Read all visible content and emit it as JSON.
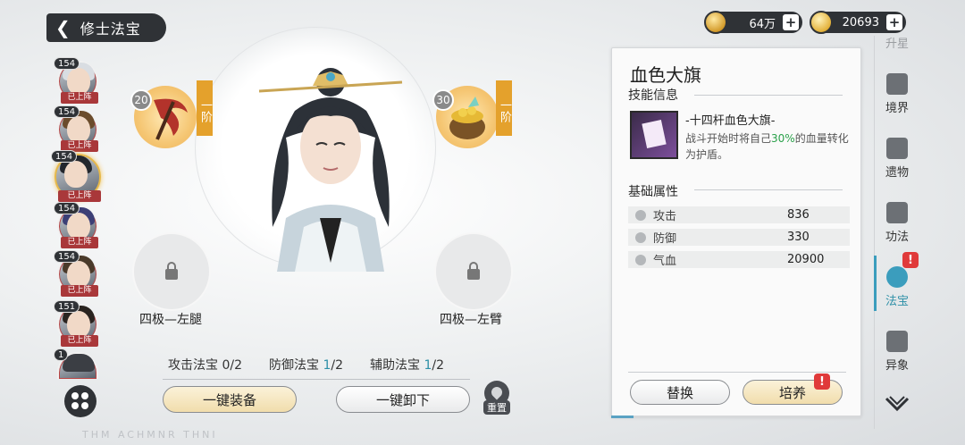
{
  "header": {
    "title": "修士法宝",
    "currencies": [
      {
        "icon": "copper-coin-icon",
        "value": "64万"
      },
      {
        "icon": "gold-ingot-icon",
        "value": "20693"
      }
    ]
  },
  "roster": [
    {
      "level": "154",
      "tag": "已上阵"
    },
    {
      "level": "154",
      "tag": "已上阵"
    },
    {
      "level": "154",
      "tag": "已上阵"
    },
    {
      "level": "154",
      "tag": "已上阵"
    },
    {
      "level": "154",
      "tag": "已上阵"
    },
    {
      "level": "151",
      "tag": "已上阵"
    },
    {
      "level": "1",
      "tag": ""
    }
  ],
  "slots": {
    "left_treasure": {
      "level": "20",
      "grade": "一阶"
    },
    "right_treasure": {
      "level": "30",
      "grade": "一阶"
    },
    "lock_left": "四极—左腿",
    "lock_right": "四极—左臂"
  },
  "counters": {
    "attack_label": "攻击法宝",
    "attack_value": "0/2",
    "defense_label": "防御法宝",
    "defense_cur": "1",
    "defense_max": "/2",
    "support_label": "辅助法宝",
    "support_cur": "1",
    "support_max": "/2"
  },
  "actions": {
    "equip_all": "一键装备",
    "unequip_all": "一键卸下",
    "reset": "重置"
  },
  "footer_text": "THM ACHMNR THNI",
  "panel": {
    "title": "血色大旗",
    "skill_section": "技能信息",
    "skill_name": "-十四杆血色大旗-",
    "skill_desc_pre": "战斗开始时将自己",
    "skill_desc_pct": "30%",
    "skill_desc_post": "的血量转化为护盾。",
    "attr_section": "基础属性",
    "stats": [
      {
        "name": "攻击",
        "value": "836",
        "icon": "sword-icon"
      },
      {
        "name": "防御",
        "value": "330",
        "icon": "shield-icon"
      },
      {
        "name": "气血",
        "value": "20900",
        "icon": "heart-icon"
      }
    ],
    "replace_label": "替换",
    "cultivate_label": "培养",
    "progress": 0.09
  },
  "nav": {
    "partial_top": "升星",
    "items": [
      {
        "label": "境界",
        "icon": "flame-icon"
      },
      {
        "label": "遗物",
        "icon": "relic-icon"
      },
      {
        "label": "功法",
        "icon": "lotus-icon"
      },
      {
        "label": "法宝",
        "icon": "treasure-icon"
      },
      {
        "label": "异象",
        "icon": "vision-icon"
      }
    ]
  },
  "colors": {
    "accent": "#3b9dbd",
    "highlight": "#2d8fa7",
    "alert": "#e03a3a",
    "grade": "#e4a12c",
    "bonus_green": "#2aa14a"
  }
}
